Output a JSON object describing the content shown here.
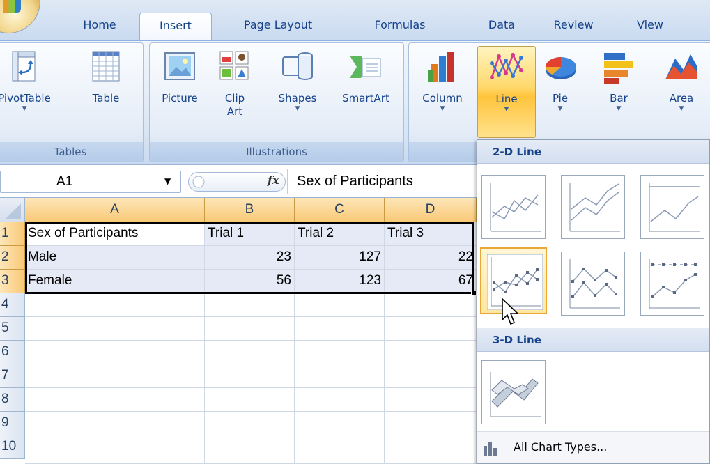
{
  "tabs": [
    "Home",
    "Insert",
    "Page Layout",
    "Formulas",
    "Data",
    "Review",
    "View"
  ],
  "active_tab": "Insert",
  "groups": {
    "tables": {
      "label": "Tables",
      "buttons": [
        {
          "label": "PivotTable",
          "icon": "pivottable-icon"
        },
        {
          "label": "Table",
          "icon": "table-icon"
        }
      ]
    },
    "illustrations": {
      "label": "Illustrations",
      "buttons": [
        {
          "label": "Picture",
          "icon": "picture-icon"
        },
        {
          "label": "Clip Art",
          "line1": "Clip",
          "line2": "Art",
          "icon": "clip-art-icon"
        },
        {
          "label": "Shapes",
          "icon": "shapes-icon"
        },
        {
          "label": "SmartArt",
          "icon": "smartart-icon"
        }
      ]
    },
    "charts": {
      "buttons": [
        {
          "label": "Column",
          "icon": "column-chart-icon"
        },
        {
          "label": "Line",
          "icon": "line-chart-icon"
        },
        {
          "label": "Pie",
          "icon": "pie-chart-icon"
        },
        {
          "label": "Bar",
          "icon": "bar-chart-icon"
        },
        {
          "label": "Area",
          "icon": "area-chart-icon"
        }
      ]
    }
  },
  "formula_bar": {
    "name_box": "A1",
    "fx_label": "fx",
    "formula": "Sex of Participants"
  },
  "grid": {
    "columns": [
      "A",
      "B",
      "C",
      "D"
    ],
    "rows": [
      "1",
      "2",
      "3",
      "4",
      "5",
      "6",
      "7",
      "8",
      "9",
      "10"
    ],
    "cells": [
      [
        "Sex of Participants",
        "Trial 1",
        "Trial 2",
        "Trial 3"
      ],
      [
        "Male",
        "23",
        "127",
        "22"
      ],
      [
        "Female",
        "56",
        "123",
        "67"
      ]
    ]
  },
  "dropdown": {
    "section_2d": "2-D Line",
    "section_3d": "3-D Line",
    "footer": "All Chart Types...",
    "thumbnails_2d": [
      "line",
      "stacked-line",
      "100-percent-stacked-line",
      "line-with-markers",
      "stacked-line-with-markers",
      "100-percent-stacked-line-with-markers"
    ],
    "thumbnails_3d": [
      "3d-line"
    ],
    "hovered": "line-with-markers"
  },
  "colors": {
    "ribbon_text": "#15428b",
    "selected_header": "#f9c977",
    "selection_fill": "#e6eaf6",
    "hover_highlight": "#ffd86b"
  }
}
